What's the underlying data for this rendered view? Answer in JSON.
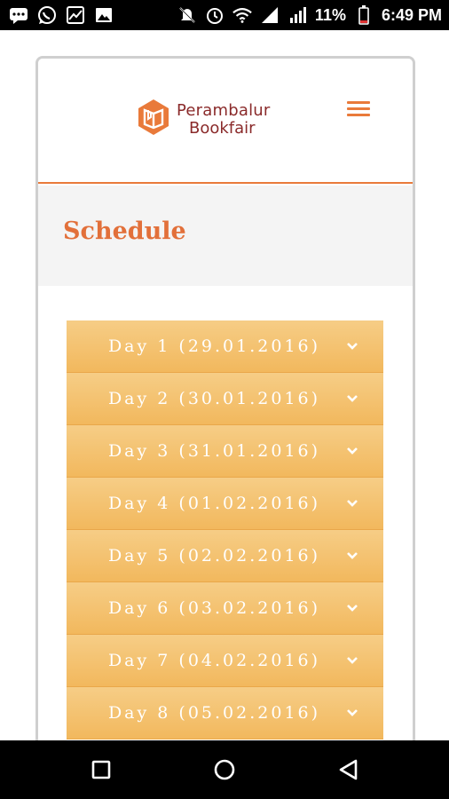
{
  "status_bar": {
    "battery_percent": "11%",
    "time": "6:49 PM",
    "icons": [
      "message-icon",
      "whatsapp-icon",
      "gallery-icon",
      "image-icon",
      "silent-icon",
      "alarm-icon",
      "wifi-icon",
      "signal-icon",
      "signal-icon",
      "battery-icon"
    ]
  },
  "header": {
    "logo_line1": "Perambalur",
    "logo_line2": "Bookfair"
  },
  "page": {
    "title": "Schedule"
  },
  "schedule": {
    "days": [
      {
        "label": "Day 1 (29.01.2016)"
      },
      {
        "label": "Day 2 (30.01.2016)"
      },
      {
        "label": "Day 3 (31.01.2016)"
      },
      {
        "label": "Day 4 (01.02.2016)"
      },
      {
        "label": "Day 5 (02.02.2016)"
      },
      {
        "label": "Day 6 (03.02.2016)"
      },
      {
        "label": "Day 7 (04.02.2016)"
      },
      {
        "label": "Day 8 (05.02.2016)"
      }
    ]
  },
  "colors": {
    "brand_orange": "#e97a3a",
    "accordion_fill": "#f4c472",
    "title_band": "#f4f4f4"
  }
}
